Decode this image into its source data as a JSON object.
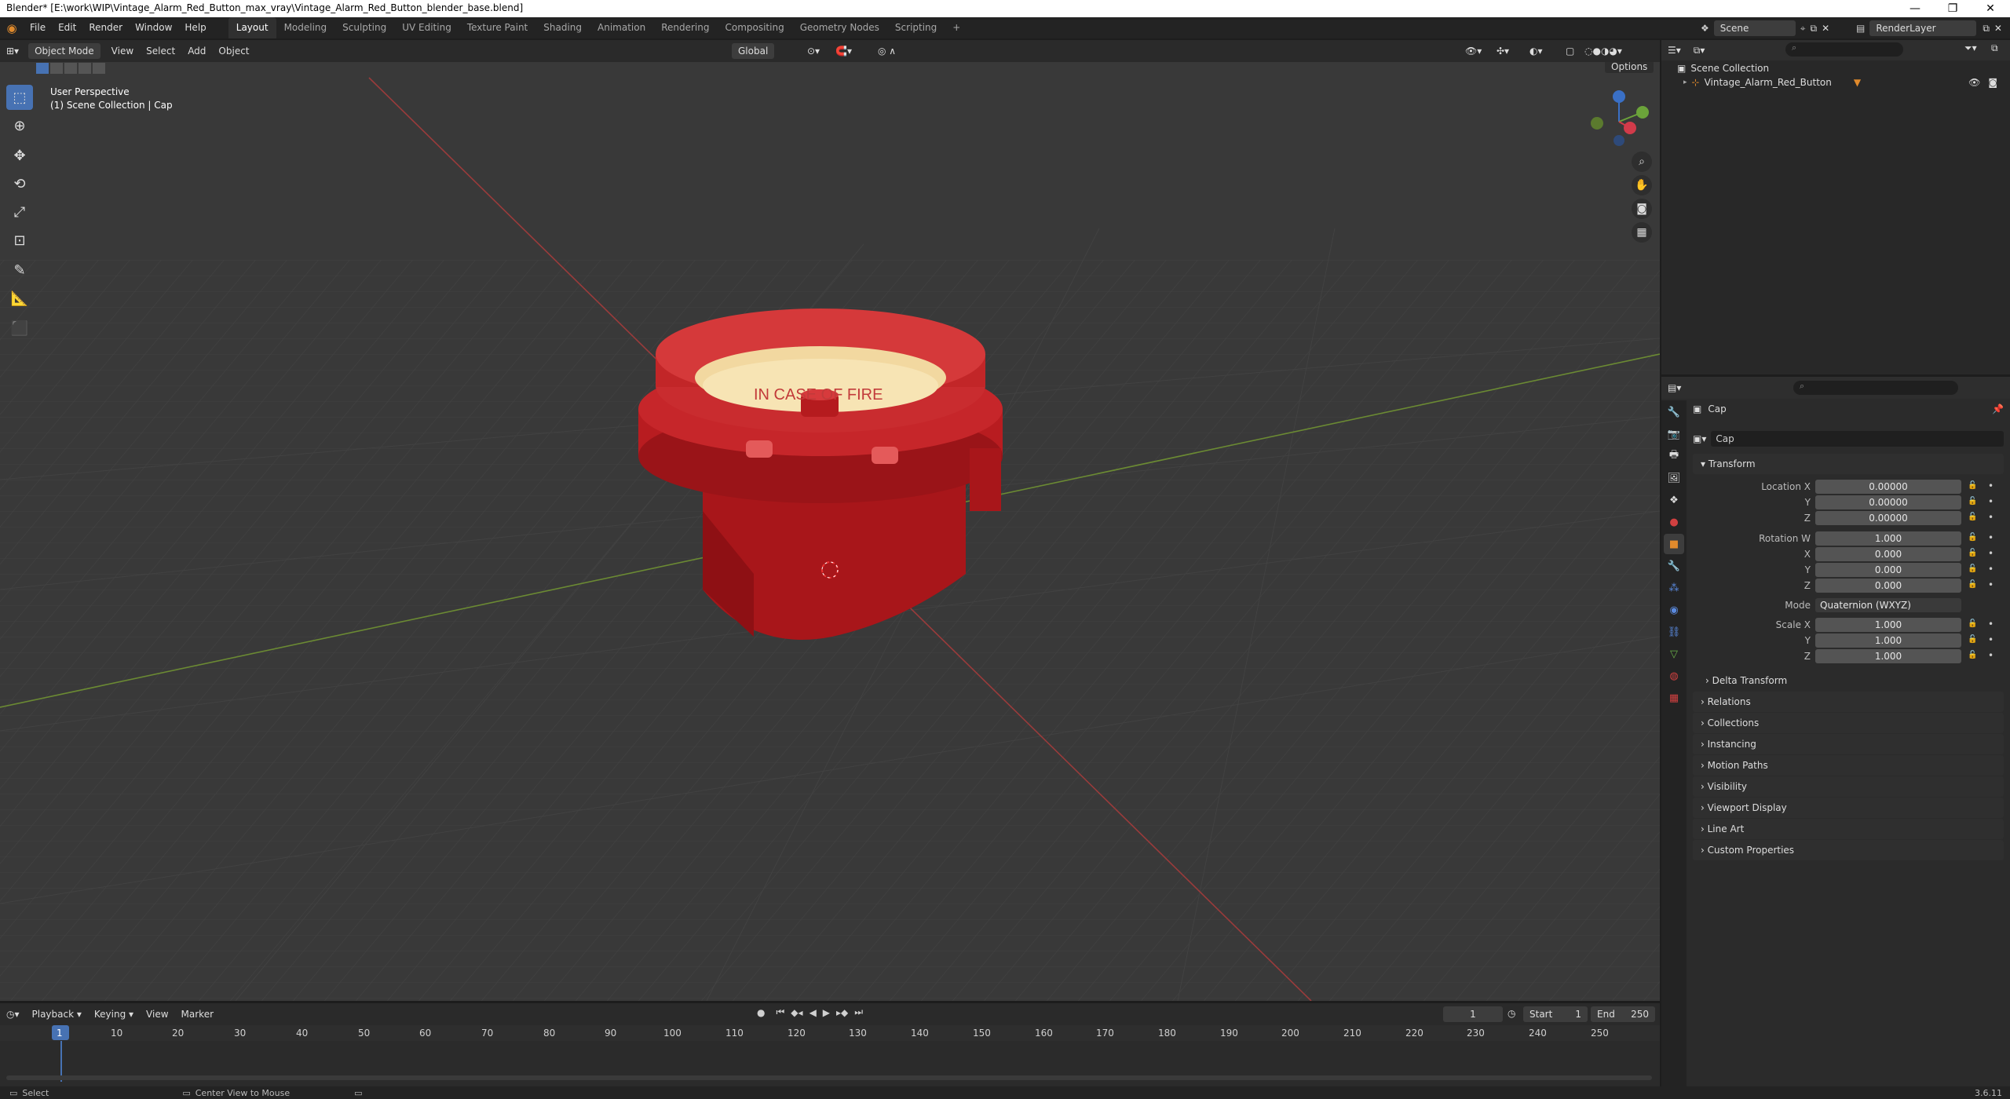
{
  "window": {
    "title": "Blender* [E:\\work\\WIP\\Vintage_Alarm_Red_Button_max_vray\\Vintage_Alarm_Red_Button_blender_base.blend]"
  },
  "menu": [
    "File",
    "Edit",
    "Render",
    "Window",
    "Help"
  ],
  "workspaces": [
    "Layout",
    "Modeling",
    "Sculpting",
    "UV Editing",
    "Texture Paint",
    "Shading",
    "Animation",
    "Rendering",
    "Compositing",
    "Geometry Nodes",
    "Scripting"
  ],
  "active_workspace": "Layout",
  "scene": {
    "name": "Scene",
    "render_layer": "RenderLayer"
  },
  "viewport": {
    "mode": "Object Mode",
    "menus": [
      "View",
      "Select",
      "Add",
      "Object"
    ],
    "orientation": "Global",
    "options": "Options",
    "perspective": "User Perspective",
    "collection_info": "(1) Scene Collection | Cap",
    "object_label": "IN CASE OF FIRE"
  },
  "outliner": {
    "root": "Scene Collection",
    "items": [
      {
        "name": "Vintage_Alarm_Red_Button"
      }
    ]
  },
  "properties": {
    "object_name": "Cap",
    "datablock": "Cap",
    "transform_title": "Transform",
    "location": {
      "label_x": "Location X",
      "label_y": "Y",
      "label_z": "Z",
      "x": "0.00000",
      "y": "0.00000",
      "z": "0.00000"
    },
    "rotation": {
      "label_w": "Rotation W",
      "label_x": "X",
      "label_y": "Y",
      "label_z": "Z",
      "w": "1.000",
      "x": "0.000",
      "y": "0.000",
      "z": "0.000"
    },
    "mode": {
      "label": "Mode",
      "value": "Quaternion (WXYZ)"
    },
    "scale": {
      "label_x": "Scale X",
      "label_y": "Y",
      "label_z": "Z",
      "x": "1.000",
      "y": "1.000",
      "z": "1.000"
    },
    "delta": "Delta Transform",
    "sections": [
      "Relations",
      "Collections",
      "Instancing",
      "Motion Paths",
      "Visibility",
      "Viewport Display",
      "Line Art",
      "Custom Properties"
    ]
  },
  "timeline": {
    "menus": [
      "Playback",
      "Keying",
      "View",
      "Marker"
    ],
    "current_frame": "1",
    "start_label": "Start",
    "start": "1",
    "end_label": "End",
    "end": "250",
    "ruler": [
      "1",
      "10",
      "20",
      "30",
      "40",
      "50",
      "60",
      "70",
      "80",
      "90",
      "100",
      "110",
      "120",
      "130",
      "140",
      "150",
      "160",
      "170",
      "180",
      "190",
      "200",
      "210",
      "220",
      "230",
      "240",
      "250"
    ]
  },
  "status": {
    "select": "Select",
    "center": "Center View to Mouse",
    "version": "3.6.11"
  }
}
